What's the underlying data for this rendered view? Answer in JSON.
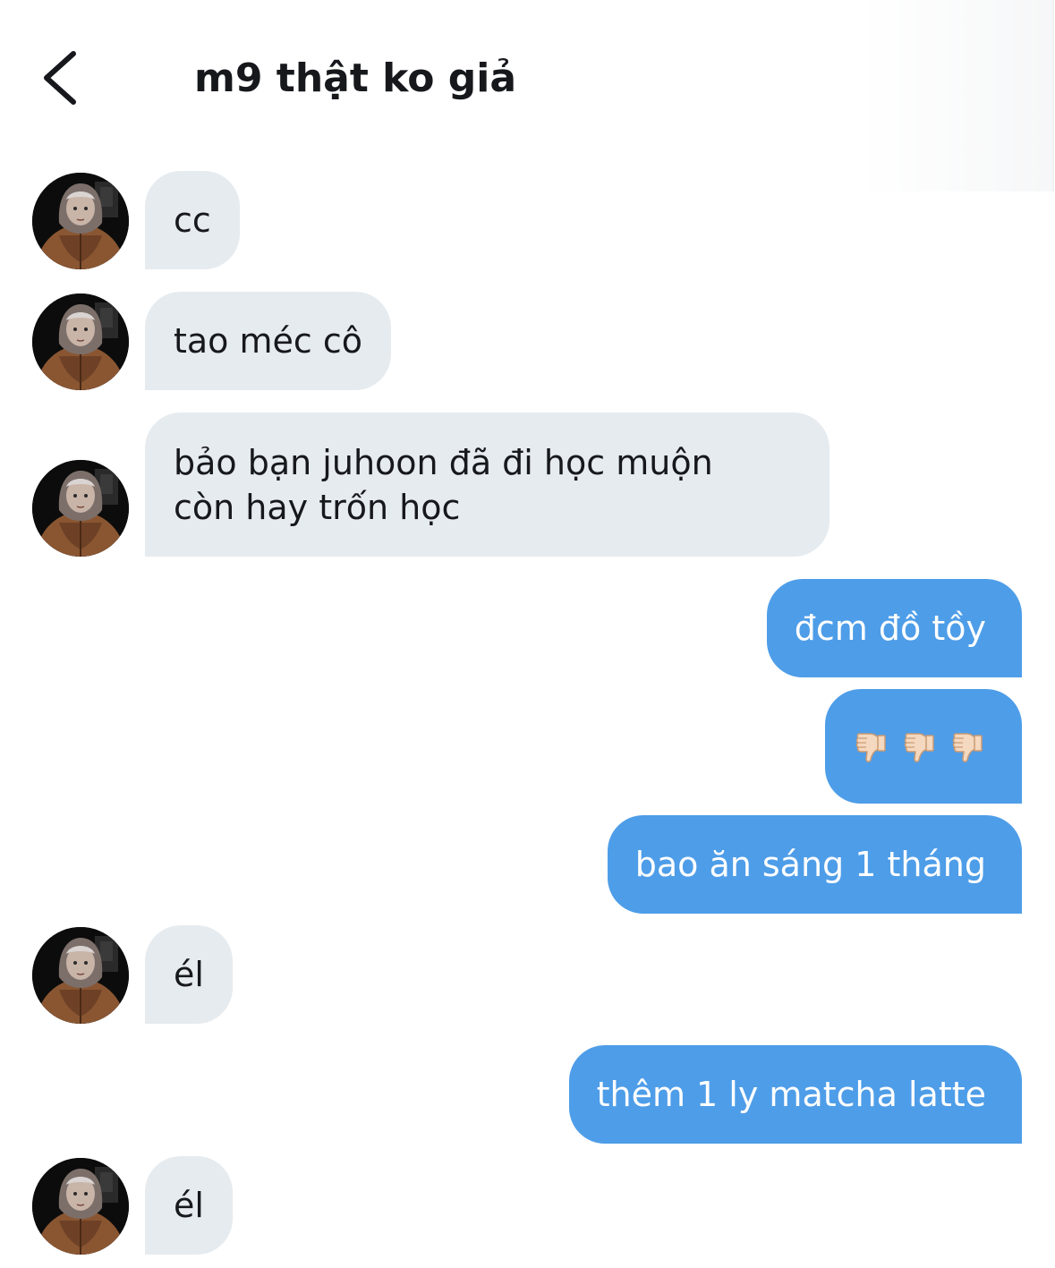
{
  "header": {
    "title": "m9 thật ko giả",
    "back_icon": "chevron-left-icon"
  },
  "colors": {
    "incoming_bubble": "#e6ebef",
    "outgoing_bubble": "#4e9de8",
    "text": "#16181c"
  },
  "messages": [
    {
      "direction": "incoming",
      "text": "cc"
    },
    {
      "direction": "incoming",
      "text": "tao méc cô"
    },
    {
      "direction": "incoming",
      "lines": [
        "bảo bạn juhoon đã đi học muộn",
        "còn hay trốn học"
      ]
    },
    {
      "direction": "outgoing",
      "text": "đcm đồ tồy"
    },
    {
      "direction": "outgoing",
      "emoji": [
        "thumbs-down-icon",
        "thumbs-down-icon",
        "thumbs-down-icon"
      ]
    },
    {
      "direction": "outgoing",
      "text": "bao ăn sáng 1 tháng"
    },
    {
      "direction": "incoming",
      "text": "él"
    },
    {
      "direction": "outgoing",
      "text": "thêm 1 ly matcha latte"
    },
    {
      "direction": "incoming",
      "text": "él"
    }
  ]
}
